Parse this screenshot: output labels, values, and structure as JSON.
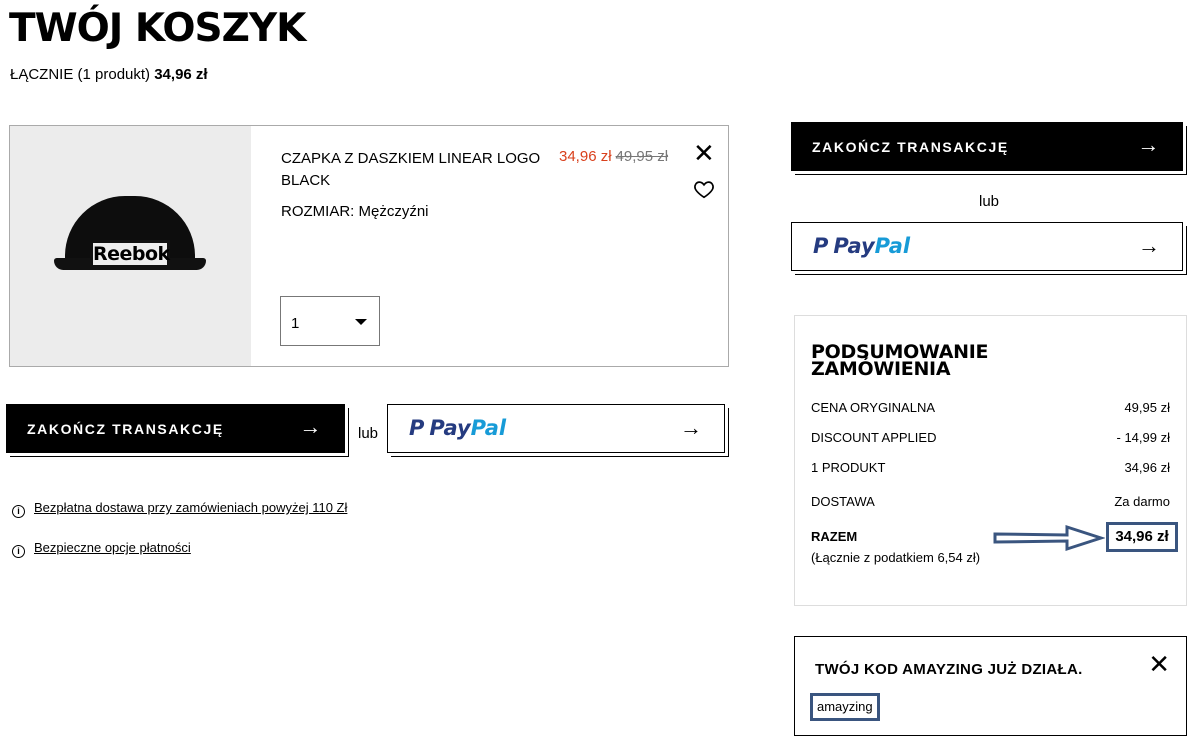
{
  "header": {
    "title": "TWÓJ KOSZYK",
    "total_prefix": "ŁĄCZNIE (1 produkt)",
    "total_value": "34,96 zł"
  },
  "product": {
    "brand_logo_text": "Reebok",
    "name": "CZAPKA Z DASZKIEM LINEAR LOGO BLACK",
    "size_label": "ROZMIAR: Mężczyźni",
    "price_now": "34,96 zł",
    "price_old": "49,95 zł",
    "quantity": "1",
    "remove_icon": "close-icon",
    "wishlist_icon": "heart-icon"
  },
  "checkout": {
    "button_label": "ZAKOŃCZ TRANSAKCJĘ",
    "or_label": "lub",
    "paypal_part1": "Pay",
    "paypal_part2": "Pal",
    "arrow": "→"
  },
  "info_links": [
    {
      "icon": "info-icon",
      "text": "Bezpłatna dostawa przy zamówieniach powyżej 110 Zł"
    },
    {
      "icon": "info-icon",
      "text": "Bezpieczne opcje płatności"
    }
  ],
  "summary": {
    "title_line1": "PODSUMOWANIE",
    "title_line2": "ZAMÓWIENIA",
    "rows": [
      {
        "label": "CENA ORYGINALNA",
        "value": "49,95 zł"
      },
      {
        "label": "DISCOUNT APPLIED",
        "value": "- 14,99 zł"
      },
      {
        "label": "1 PRODUKT",
        "value": "34,96 zł"
      },
      {
        "label": "DOSTAWA",
        "value": "Za darmo"
      }
    ],
    "total_label": "RAZEM",
    "total_value": "34,96 zł",
    "tax_note": "(Łącznie z podatkiem  6,54 zł)"
  },
  "promo": {
    "title": "TWÓJ KOD AMAYZING JUŻ DZIAŁA.",
    "code": "amayzing"
  },
  "colors": {
    "sale_price": "#d9401c",
    "annotation_blue": "#3a557f",
    "paypal_dark": "#253b80",
    "paypal_light": "#179bd7"
  }
}
